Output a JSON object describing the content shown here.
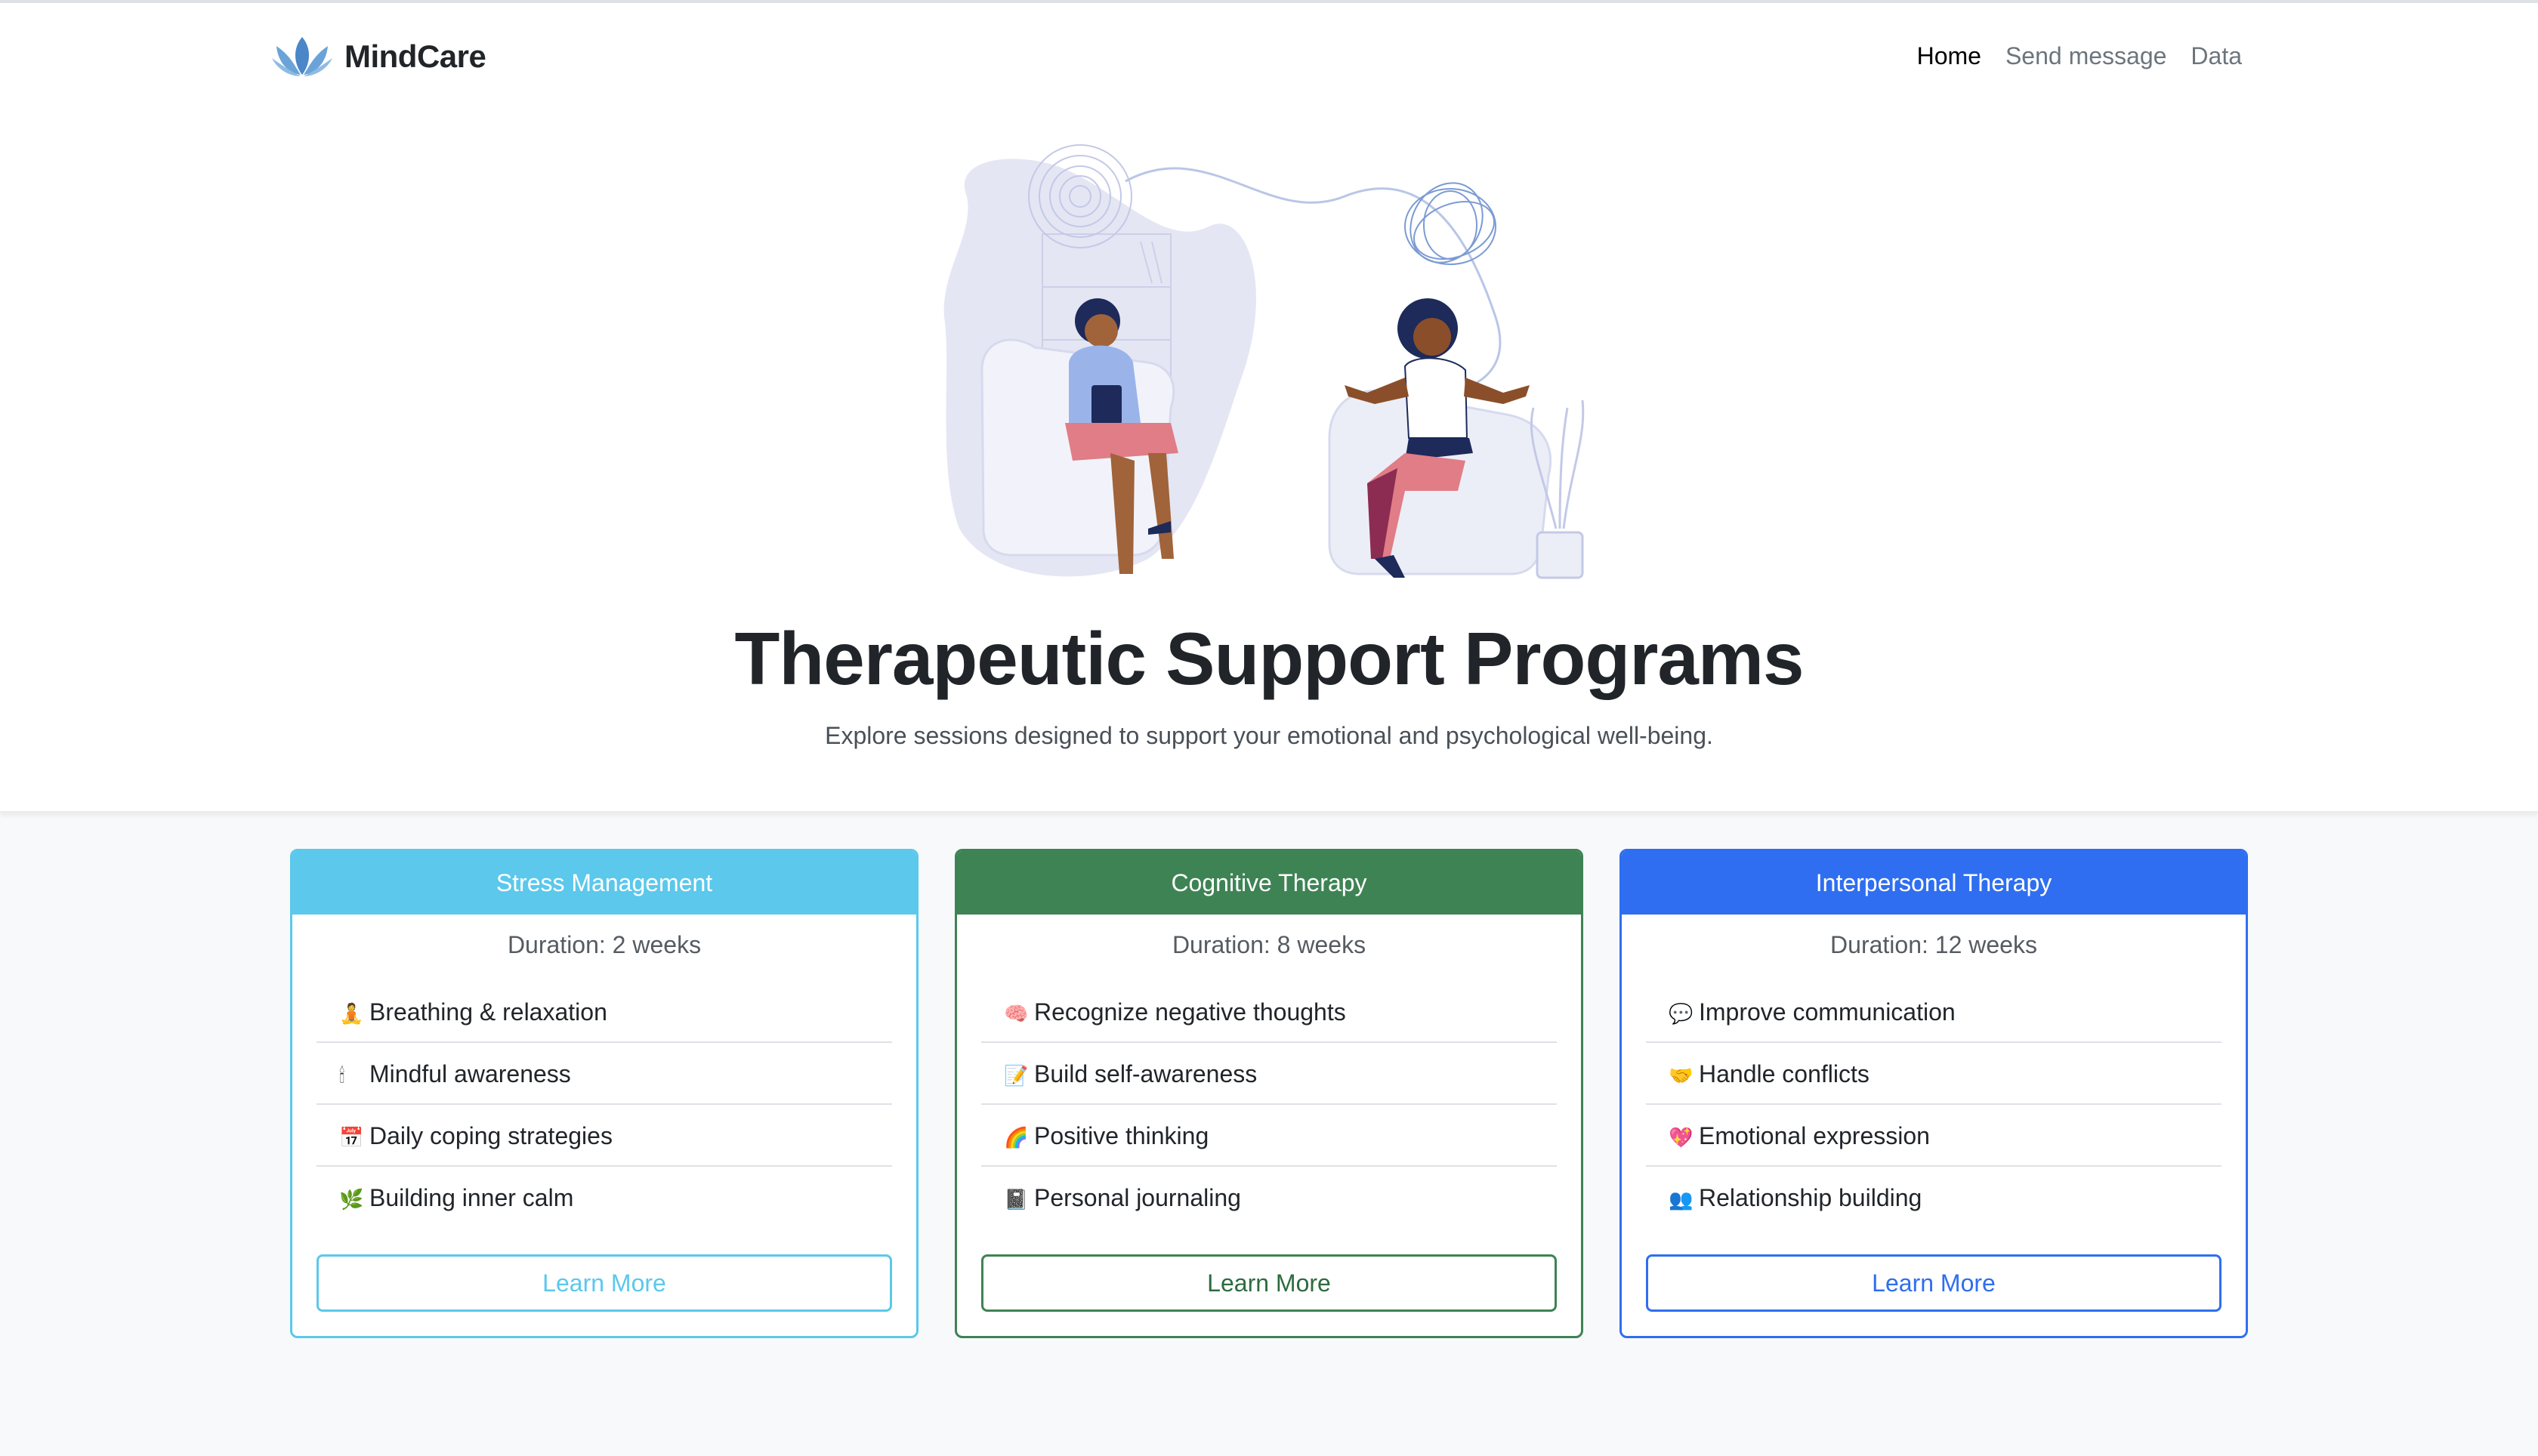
{
  "brand": {
    "name": "MindCare",
    "logo_icon": "lotus-icon"
  },
  "nav": {
    "items": [
      {
        "label": "Home",
        "active": true
      },
      {
        "label": "Send message",
        "active": false
      },
      {
        "label": "Data",
        "active": false
      }
    ]
  },
  "hero": {
    "illustration": "therapy-session-illustration",
    "title": "Therapeutic Support Programs",
    "subtitle": "Explore sessions designed to support your emotional and psychological well-being."
  },
  "cards": [
    {
      "title": "Stress Management",
      "color": "#5bc8ec",
      "duration": "Duration: 2 weeks",
      "features": [
        {
          "icon": "meditation-icon",
          "emoji": "🧘",
          "label": "Breathing & relaxation"
        },
        {
          "icon": "candle-icon",
          "emoji": "🕯",
          "label": "Mindful awareness"
        },
        {
          "icon": "calendar-icon",
          "emoji": "📅",
          "label": "Daily coping strategies"
        },
        {
          "icon": "herb-icon",
          "emoji": "🌿",
          "label": "Building inner calm"
        }
      ],
      "button": "Learn More"
    },
    {
      "title": "Cognitive Therapy",
      "color": "#3e8354",
      "duration": "Duration: 8 weeks",
      "features": [
        {
          "icon": "brain-icon",
          "emoji": "🧠",
          "label": "Recognize negative thoughts"
        },
        {
          "icon": "memo-icon",
          "emoji": "📝",
          "label": "Build self-awareness"
        },
        {
          "icon": "rainbow-icon",
          "emoji": "🌈",
          "label": "Positive thinking"
        },
        {
          "icon": "notebook-icon",
          "emoji": "📓",
          "label": "Personal journaling"
        }
      ],
      "button": "Learn More"
    },
    {
      "title": "Interpersonal Therapy",
      "color": "#2f6ef0",
      "duration": "Duration: 12 weeks",
      "features": [
        {
          "icon": "speech-bubble-icon",
          "emoji": "💬",
          "label": "Improve communication"
        },
        {
          "icon": "handshake-icon",
          "emoji": "🤝",
          "label": "Handle conflicts"
        },
        {
          "icon": "heart-icon",
          "emoji": "💖",
          "label": "Emotional expression"
        },
        {
          "icon": "people-icon",
          "emoji": "👥",
          "label": "Relationship building"
        }
      ],
      "button": "Learn More"
    }
  ]
}
